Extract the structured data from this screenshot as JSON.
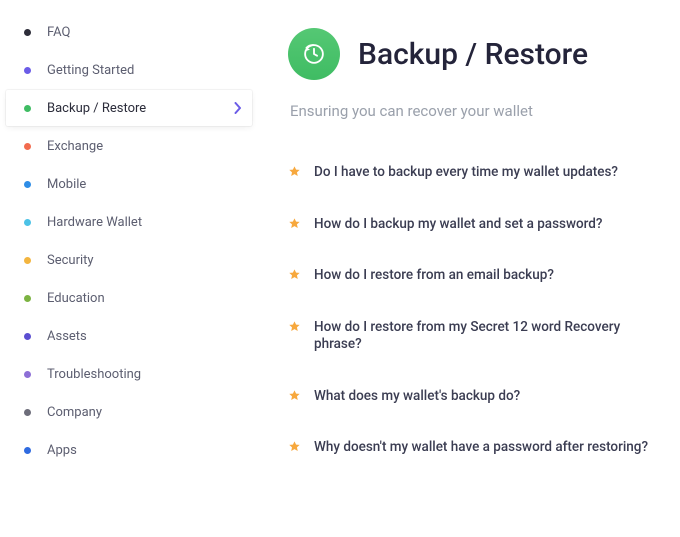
{
  "sidebar": {
    "items": [
      {
        "label": "FAQ",
        "color": "#2d2d3a",
        "active": false
      },
      {
        "label": "Getting Started",
        "color": "#6b5ce7",
        "active": false
      },
      {
        "label": "Backup / Restore",
        "color": "#3fbc63",
        "active": true
      },
      {
        "label": "Exchange",
        "color": "#f26b4e",
        "active": false
      },
      {
        "label": "Mobile",
        "color": "#2e8de6",
        "active": false
      },
      {
        "label": "Hardware Wallet",
        "color": "#4cc2e6",
        "active": false
      },
      {
        "label": "Security",
        "color": "#f3b53f",
        "active": false
      },
      {
        "label": "Education",
        "color": "#7cb342",
        "active": false
      },
      {
        "label": "Assets",
        "color": "#5b4ed1",
        "active": false
      },
      {
        "label": "Troubleshooting",
        "color": "#8d6fd6",
        "active": false
      },
      {
        "label": "Company",
        "color": "#6d6d7a",
        "active": false
      },
      {
        "label": "Apps",
        "color": "#2f6be0",
        "active": false
      }
    ]
  },
  "page": {
    "title": "Backup / Restore",
    "subtitle": "Ensuring you can recover your wallet",
    "icon": "restore-icon"
  },
  "faq": {
    "items": [
      {
        "question": "Do I have to backup every time my wallet updates?"
      },
      {
        "question": "How do I backup my wallet and set a password?"
      },
      {
        "question": "How do I restore from an email backup?"
      },
      {
        "question": "How do I restore from my Secret 12 word Recovery phrase?"
      },
      {
        "question": "What does my wallet's backup do?"
      },
      {
        "question": "Why doesn't my wallet have a password after restoring?"
      }
    ]
  }
}
